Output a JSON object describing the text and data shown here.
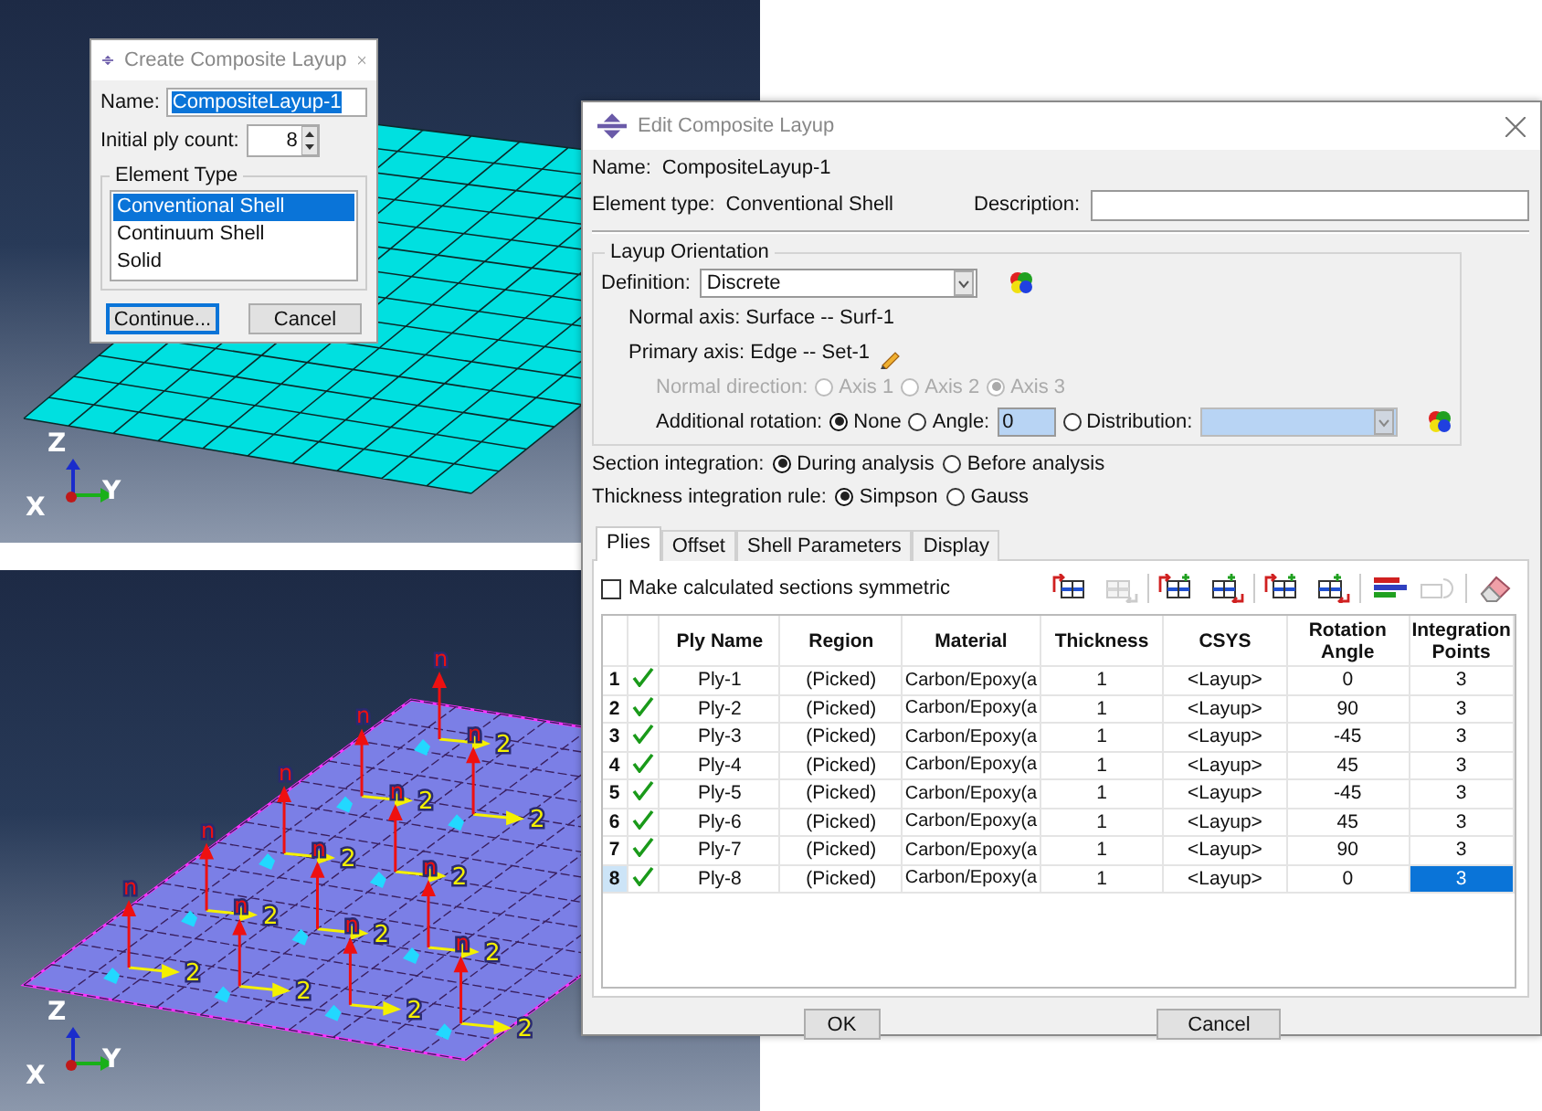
{
  "create_dialog": {
    "title": "Create Composite Layup",
    "name_label": "Name:",
    "name_value": "CompositeLayup-1",
    "ply_count_label": "Initial ply count:",
    "ply_count_value": "8",
    "element_type_group": "Element Type",
    "element_types": [
      {
        "label": "Conventional Shell",
        "selected": true
      },
      {
        "label": "Continuum Shell",
        "selected": false
      },
      {
        "label": "Solid",
        "selected": false
      }
    ],
    "buttons": [
      {
        "label": "Continue...",
        "default": true
      },
      {
        "label": "Cancel",
        "default": false
      }
    ]
  },
  "top_viewport": {
    "triad": {
      "z": "Z",
      "y": "Y",
      "x": "X"
    }
  },
  "bottom_viewport": {
    "triad": {
      "z": "Z",
      "y": "Y",
      "x": "X"
    },
    "markers": [
      {
        "normal_label": "n",
        "primary_label": "2"
      },
      {
        "normal_label": "n",
        "primary_label": "2"
      },
      {
        "normal_label": "n",
        "primary_label": "2"
      },
      {
        "normal_label": "n",
        "primary_label": "2"
      },
      {
        "normal_label": "n",
        "primary_label": "2"
      },
      {
        "normal_label": "n",
        "primary_label": "2"
      },
      {
        "normal_label": "n",
        "primary_label": "2"
      },
      {
        "normal_label": "n",
        "primary_label": "2"
      },
      {
        "normal_label": "n",
        "primary_label": "2"
      },
      {
        "normal_label": "n",
        "primary_label": "2"
      },
      {
        "normal_label": "n",
        "primary_label": "2"
      },
      {
        "normal_label": "n",
        "primary_label": "2"
      }
    ]
  },
  "edit_dialog": {
    "title": "Edit Composite Layup",
    "name_label": "Name:",
    "name_value": "CompositeLayup-1",
    "element_type_label": "Element type:",
    "element_type_value": "Conventional Shell",
    "description_label": "Description:",
    "layup_orientation": {
      "title": "Layup Orientation",
      "definition_label": "Definition:",
      "definition_value": "Discrete",
      "normal_axis": "Normal axis: Surface -- Surf-1",
      "primary_axis": "Primary axis: Edge -- Set-1",
      "normal_direction": {
        "label": "Normal direction:",
        "disabled": true,
        "options": [
          {
            "label": "Axis 1",
            "selected": false
          },
          {
            "label": "Axis 2",
            "selected": false
          },
          {
            "label": "Axis 3",
            "selected": true
          }
        ]
      },
      "additional_rotation": {
        "label": "Additional rotation:",
        "options": [
          {
            "label": "None",
            "selected": true
          },
          {
            "label": "Angle:",
            "selected": false
          },
          {
            "label": "Distribution:",
            "selected": false
          }
        ],
        "angle_value": "0"
      }
    },
    "section_integration": {
      "label": "Section integration:",
      "options": [
        {
          "label": "During analysis",
          "selected": true
        },
        {
          "label": "Before analysis",
          "selected": false
        }
      ]
    },
    "thickness_rule": {
      "label": "Thickness integration rule:",
      "options": [
        {
          "label": "Simpson",
          "selected": true
        },
        {
          "label": "Gauss",
          "selected": false
        }
      ]
    },
    "tabs": [
      {
        "label": "Plies",
        "selected": true
      },
      {
        "label": "Offset",
        "selected": false
      },
      {
        "label": "Shell Parameters",
        "selected": false
      },
      {
        "label": "Display",
        "selected": false
      }
    ],
    "symmetric": {
      "label": "Make calculated sections symmetric",
      "checked": false
    },
    "tools": [
      {
        "kind": "insert-before",
        "disabled": false
      },
      {
        "kind": "insert-after",
        "disabled": true
      },
      {
        "kind": "add-above",
        "disabled": false
      },
      {
        "kind": "add-below",
        "disabled": false
      },
      {
        "kind": "copy-above",
        "disabled": false
      },
      {
        "kind": "copy-below",
        "disabled": false
      },
      {
        "kind": "plot",
        "disabled": false
      },
      {
        "kind": "rotate",
        "disabled": true
      },
      {
        "kind": "erase",
        "disabled": false
      }
    ],
    "table": {
      "columns": [
        "Ply Name",
        "Region",
        "Material",
        "Thickness",
        "CSYS",
        "Rotation Angle",
        "Integration Points"
      ],
      "rows": [
        {
          "number": "1",
          "valid": true,
          "selected": false,
          "cells": [
            "Ply-1",
            "(Picked)",
            "Carbon/Epoxy(a",
            "1",
            "<Layup>",
            "0",
            "3"
          ]
        },
        {
          "number": "2",
          "valid": true,
          "selected": false,
          "cells": [
            "Ply-2",
            "(Picked)",
            "Carbon/Epoxy(a",
            "1",
            "<Layup>",
            "90",
            "3"
          ]
        },
        {
          "number": "3",
          "valid": true,
          "selected": false,
          "cells": [
            "Ply-3",
            "(Picked)",
            "Carbon/Epoxy(a",
            "1",
            "<Layup>",
            "-45",
            "3"
          ]
        },
        {
          "number": "4",
          "valid": true,
          "selected": false,
          "cells": [
            "Ply-4",
            "(Picked)",
            "Carbon/Epoxy(a",
            "1",
            "<Layup>",
            "45",
            "3"
          ]
        },
        {
          "number": "5",
          "valid": true,
          "selected": false,
          "cells": [
            "Ply-5",
            "(Picked)",
            "Carbon/Epoxy(a",
            "1",
            "<Layup>",
            "-45",
            "3"
          ]
        },
        {
          "number": "6",
          "valid": true,
          "selected": false,
          "cells": [
            "Ply-6",
            "(Picked)",
            "Carbon/Epoxy(a",
            "1",
            "<Layup>",
            "45",
            "3"
          ]
        },
        {
          "number": "7",
          "valid": true,
          "selected": false,
          "cells": [
            "Ply-7",
            "(Picked)",
            "Carbon/Epoxy(a",
            "1",
            "<Layup>",
            "90",
            "3"
          ]
        },
        {
          "number": "8",
          "valid": true,
          "selected": true,
          "cells": [
            "Ply-8",
            "(Picked)",
            "Carbon/Epoxy(a",
            "1",
            "<Layup>",
            "0",
            "3"
          ]
        }
      ]
    },
    "buttons": [
      "OK",
      "Cancel"
    ]
  }
}
